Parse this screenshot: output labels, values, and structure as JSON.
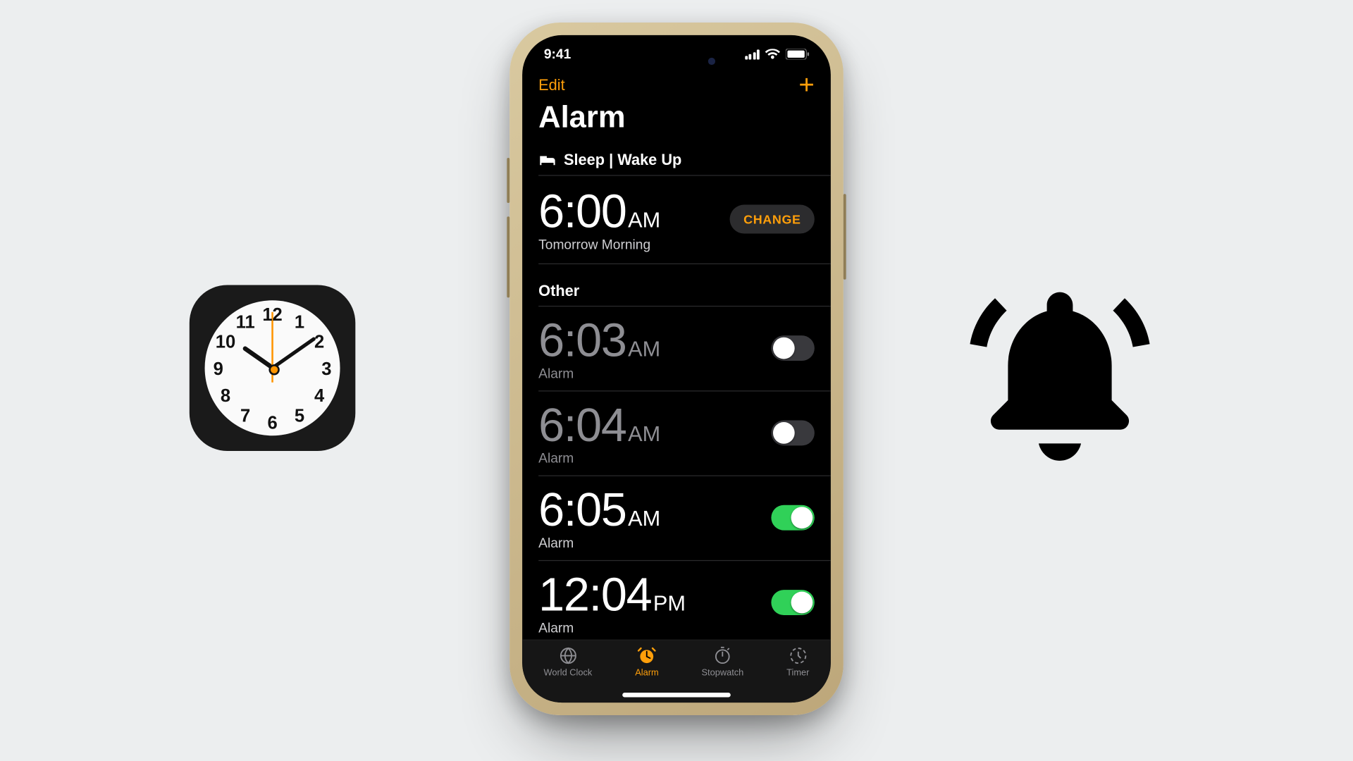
{
  "statusbar": {
    "time": "9:41"
  },
  "nav": {
    "edit_label": "Edit"
  },
  "title": "Alarm",
  "sleep_section": {
    "header": "Sleep | Wake Up",
    "time": "6:00",
    "ampm": "AM",
    "subtitle": "Tomorrow Morning",
    "change_label": "CHANGE"
  },
  "other_section": {
    "header": "Other",
    "alarms": [
      {
        "time": "6:03",
        "ampm": "AM",
        "label": "Alarm",
        "on": false
      },
      {
        "time": "6:04",
        "ampm": "AM",
        "label": "Alarm",
        "on": false
      },
      {
        "time": "6:05",
        "ampm": "AM",
        "label": "Alarm",
        "on": true
      },
      {
        "time": "12:04",
        "ampm": "PM",
        "label": "Alarm",
        "on": true
      }
    ],
    "peek_time": "12:04"
  },
  "tabs": {
    "world_clock": "World Clock",
    "alarm": "Alarm",
    "stopwatch": "Stopwatch",
    "timer": "Timer",
    "active": "alarm"
  },
  "clockface_numbers": [
    "12",
    "1",
    "2",
    "3",
    "4",
    "5",
    "6",
    "7",
    "8",
    "9",
    "10",
    "11"
  ],
  "colors": {
    "accent": "#ff9f0a",
    "toggle_on": "#30d158"
  }
}
